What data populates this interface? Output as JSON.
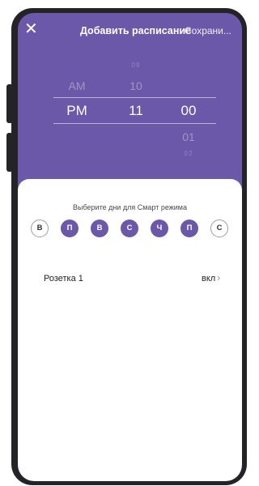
{
  "header": {
    "close_icon": "close-icon",
    "title": "Добавить расписание",
    "save_label": "Сохрани..."
  },
  "picker": {
    "ampm": {
      "above": "AM",
      "selected": "PM"
    },
    "hours": {
      "top_partial": "09",
      "above": "10",
      "selected": "11"
    },
    "minutes": {
      "selected": "00",
      "below": "01",
      "bottom_partial": "02"
    }
  },
  "sheet": {
    "prompt": "Выберите дни для Смарт режима",
    "days": [
      {
        "label": "В",
        "active": false
      },
      {
        "label": "П",
        "active": true
      },
      {
        "label": "В",
        "active": true
      },
      {
        "label": "С",
        "active": true
      },
      {
        "label": "Ч",
        "active": true
      },
      {
        "label": "П",
        "active": true
      },
      {
        "label": "С",
        "active": false
      }
    ],
    "socket": {
      "name": "Розетка 1",
      "state": "вкл",
      "chevron_icon": "chevron-right-icon"
    }
  },
  "colors": {
    "accent": "#6c58a8",
    "frame": "#242428",
    "day_off_border": "#9e9e9e"
  }
}
